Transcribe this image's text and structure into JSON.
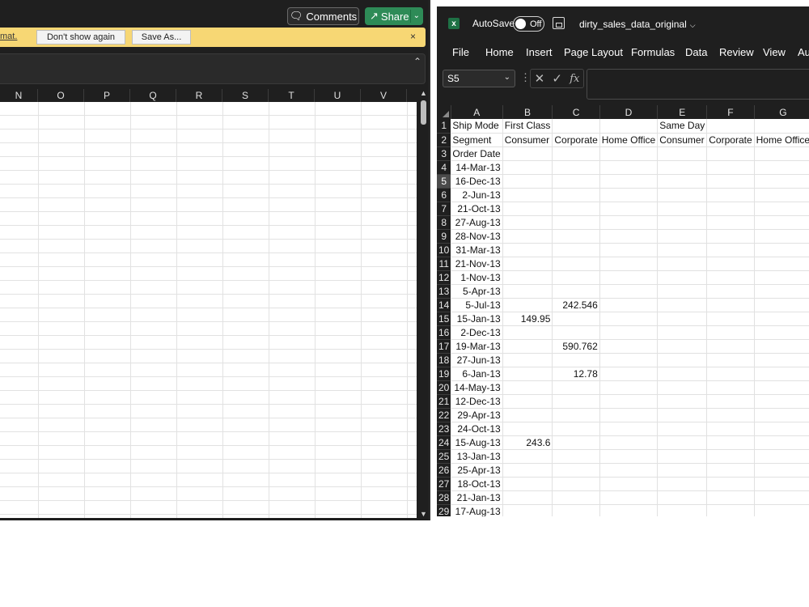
{
  "left_window": {
    "toolbar": {
      "comments_label": "Comments",
      "share_label": "Share"
    },
    "infobar": {
      "link_text": "mat.",
      "dont_show_label": "Don't show again",
      "save_as_label": "Save As...",
      "close_label": "×"
    },
    "columns": [
      "N",
      "O",
      "P",
      "Q",
      "R",
      "S",
      "T",
      "U",
      "V"
    ]
  },
  "right_window": {
    "title": {
      "autosave_label": "AutoSave",
      "toggle_state": "Off",
      "filename": "dirty_sales_data_original"
    },
    "menu": [
      "File",
      "Home",
      "Insert",
      "Page Layout",
      "Formulas",
      "Data",
      "Review",
      "View",
      "Au"
    ],
    "formula_bar": {
      "name_box": "S5",
      "formula": ""
    },
    "sheet": {
      "columns": [
        "A",
        "B",
        "C",
        "D",
        "E",
        "F",
        "G"
      ],
      "selected_row": 5,
      "rows": [
        {
          "n": "1",
          "A": "Ship Mode",
          "B": "First Class",
          "C": "",
          "D": "",
          "E": "Same Day",
          "F": "",
          "G": ""
        },
        {
          "n": "2",
          "A": "Segment",
          "B": "Consumer",
          "C": "Corporate",
          "D": "Home Office",
          "E": "Consumer",
          "F": "Corporate",
          "G": "Home Office"
        },
        {
          "n": "3",
          "A": "Order Date",
          "B": "",
          "C": "",
          "D": "",
          "E": "",
          "F": "",
          "G": ""
        },
        {
          "n": "4",
          "A": "14-Mar-13",
          "B": "",
          "C": "",
          "D": "",
          "E": "",
          "F": "",
          "G": ""
        },
        {
          "n": "5",
          "A": "16-Dec-13",
          "B": "",
          "C": "",
          "D": "",
          "E": "",
          "F": "",
          "G": ""
        },
        {
          "n": "6",
          "A": "2-Jun-13",
          "B": "",
          "C": "",
          "D": "",
          "E": "",
          "F": "",
          "G": ""
        },
        {
          "n": "7",
          "A": "21-Oct-13",
          "B": "",
          "C": "",
          "D": "",
          "E": "",
          "F": "",
          "G": ""
        },
        {
          "n": "8",
          "A": "27-Aug-13",
          "B": "",
          "C": "",
          "D": "",
          "E": "",
          "F": "",
          "G": ""
        },
        {
          "n": "9",
          "A": "28-Nov-13",
          "B": "",
          "C": "",
          "D": "",
          "E": "",
          "F": "",
          "G": ""
        },
        {
          "n": "10",
          "A": "31-Mar-13",
          "B": "",
          "C": "",
          "D": "",
          "E": "",
          "F": "",
          "G": ""
        },
        {
          "n": "11",
          "A": "21-Nov-13",
          "B": "",
          "C": "",
          "D": "",
          "E": "",
          "F": "",
          "G": ""
        },
        {
          "n": "12",
          "A": "1-Nov-13",
          "B": "",
          "C": "",
          "D": "",
          "E": "",
          "F": "",
          "G": ""
        },
        {
          "n": "13",
          "A": "5-Apr-13",
          "B": "",
          "C": "",
          "D": "",
          "E": "",
          "F": "",
          "G": ""
        },
        {
          "n": "14",
          "A": "5-Jul-13",
          "B": "",
          "C": "242.546",
          "D": "",
          "E": "",
          "F": "",
          "G": ""
        },
        {
          "n": "15",
          "A": "15-Jan-13",
          "B": "149.95",
          "C": "",
          "D": "",
          "E": "",
          "F": "",
          "G": ""
        },
        {
          "n": "16",
          "A": "2-Dec-13",
          "B": "",
          "C": "",
          "D": "",
          "E": "",
          "F": "",
          "G": ""
        },
        {
          "n": "17",
          "A": "19-Mar-13",
          "B": "",
          "C": "590.762",
          "D": "",
          "E": "",
          "F": "",
          "G": ""
        },
        {
          "n": "18",
          "A": "27-Jun-13",
          "B": "",
          "C": "",
          "D": "",
          "E": "",
          "F": "",
          "G": ""
        },
        {
          "n": "19",
          "A": "6-Jan-13",
          "B": "",
          "C": "12.78",
          "D": "",
          "E": "",
          "F": "",
          "G": ""
        },
        {
          "n": "20",
          "A": "14-May-13",
          "B": "",
          "C": "",
          "D": "",
          "E": "",
          "F": "",
          "G": ""
        },
        {
          "n": "21",
          "A": "12-Dec-13",
          "B": "",
          "C": "",
          "D": "",
          "E": "",
          "F": "",
          "G": ""
        },
        {
          "n": "22",
          "A": "29-Apr-13",
          "B": "",
          "C": "",
          "D": "",
          "E": "",
          "F": "",
          "G": ""
        },
        {
          "n": "23",
          "A": "24-Oct-13",
          "B": "",
          "C": "",
          "D": "",
          "E": "",
          "F": "",
          "G": ""
        },
        {
          "n": "24",
          "A": "15-Aug-13",
          "B": "243.6",
          "C": "",
          "D": "",
          "E": "",
          "F": "",
          "G": ""
        },
        {
          "n": "25",
          "A": "13-Jan-13",
          "B": "",
          "C": "",
          "D": "",
          "E": "",
          "F": "",
          "G": ""
        },
        {
          "n": "26",
          "A": "25-Apr-13",
          "B": "",
          "C": "",
          "D": "",
          "E": "",
          "F": "",
          "G": ""
        },
        {
          "n": "27",
          "A": "18-Oct-13",
          "B": "",
          "C": "",
          "D": "",
          "E": "",
          "F": "",
          "G": ""
        },
        {
          "n": "28",
          "A": "21-Jan-13",
          "B": "",
          "C": "",
          "D": "",
          "E": "",
          "F": "",
          "G": ""
        },
        {
          "n": "29",
          "A": "17-Aug-13",
          "B": "",
          "C": "",
          "D": "",
          "E": "",
          "F": "",
          "G": ""
        }
      ]
    }
  }
}
